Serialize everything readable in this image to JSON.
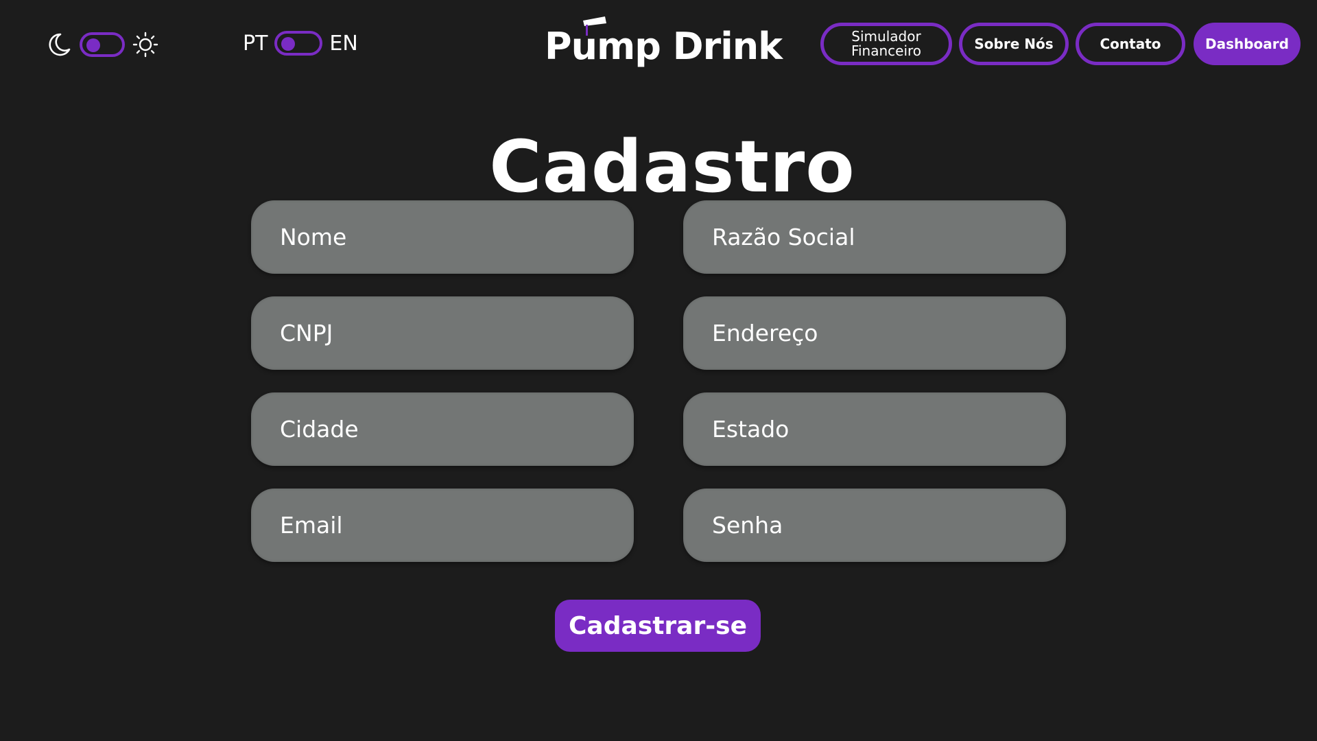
{
  "theme_toggle": {
    "left_icon": "moon-icon",
    "right_icon": "sun-icon",
    "state": "dark"
  },
  "language_toggle": {
    "left_label": "PT",
    "right_label": "EN",
    "selected": "PT"
  },
  "logo": {
    "text": "Pump Drink",
    "icon": "cup-icon"
  },
  "nav": {
    "simulador_line1": "Simulador",
    "simulador_line2": "Financeiro",
    "sobre": "Sobre Nós",
    "contato": "Contato",
    "dashboard": "Dashboard"
  },
  "page": {
    "title": "Cadastro"
  },
  "form": {
    "nome": "Nome",
    "razao_social": "Razão Social",
    "cnpj": "CNPJ",
    "endereco": "Endereço",
    "cidade": "Cidade",
    "estado": "Estado",
    "email": "Email",
    "senha": "Senha",
    "submit": "Cadastrar-se"
  },
  "colors": {
    "background": "#1c1c1c",
    "accent": "#7a2cc4",
    "field": "#737675",
    "text": "#ffffff"
  }
}
